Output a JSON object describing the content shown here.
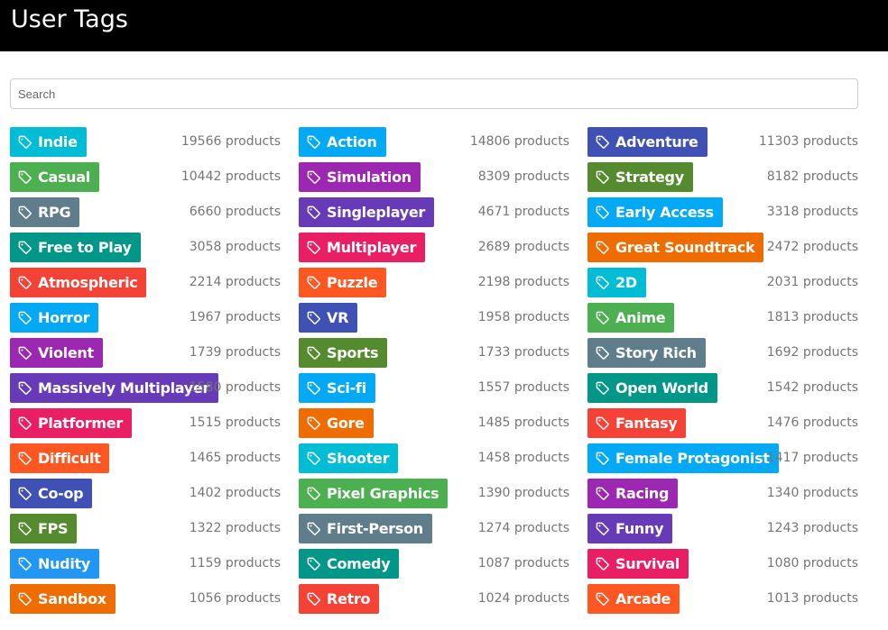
{
  "header": {
    "title": "User Tags"
  },
  "search": {
    "placeholder": "Search",
    "value": ""
  },
  "colors": {
    "cyan": "#00bcd4",
    "lightblue": "#03a9f4",
    "blue": "#2196f3",
    "indigo": "#3f51b5",
    "green": "#4caf50",
    "teal": "#009688",
    "darkgreen": "#558b2f",
    "purple": "#9c27b0",
    "deeppurple": "#673ab7",
    "pink": "#e91e63",
    "red": "#f44336",
    "deeporange": "#ff5722",
    "orange": "#ef6c00",
    "grey": "#607d8b"
  },
  "tags": [
    {
      "name": "Indie",
      "count": "19566 products",
      "color": "#00bcd4"
    },
    {
      "name": "Action",
      "count": "14806 products",
      "color": "#03a9f4"
    },
    {
      "name": "Adventure",
      "count": "11303 products",
      "color": "#3f51b5"
    },
    {
      "name": "Casual",
      "count": "10442 products",
      "color": "#4caf50"
    },
    {
      "name": "Simulation",
      "count": "8309 products",
      "color": "#9c27b0"
    },
    {
      "name": "Strategy",
      "count": "8182 products",
      "color": "#558b2f"
    },
    {
      "name": "RPG",
      "count": "6660 products",
      "color": "#607d8b"
    },
    {
      "name": "Singleplayer",
      "count": "4671 products",
      "color": "#673ab7"
    },
    {
      "name": "Early Access",
      "count": "3318 products",
      "color": "#03a9f4"
    },
    {
      "name": "Free to Play",
      "count": "3058 products",
      "color": "#009688"
    },
    {
      "name": "Multiplayer",
      "count": "2689 products",
      "color": "#e91e63"
    },
    {
      "name": "Great Soundtrack",
      "count": "2472 products",
      "color": "#ef6c00"
    },
    {
      "name": "Atmospheric",
      "count": "2214 products",
      "color": "#f44336"
    },
    {
      "name": "Puzzle",
      "count": "2198 products",
      "color": "#ff5722"
    },
    {
      "name": "2D",
      "count": "2031 products",
      "color": "#00bcd4"
    },
    {
      "name": "Horror",
      "count": "1967 products",
      "color": "#03a9f4"
    },
    {
      "name": "VR",
      "count": "1958 products",
      "color": "#3f51b5"
    },
    {
      "name": "Anime",
      "count": "1813 products",
      "color": "#4caf50"
    },
    {
      "name": "Violent",
      "count": "1739 products",
      "color": "#9c27b0"
    },
    {
      "name": "Sports",
      "count": "1733 products",
      "color": "#558b2f"
    },
    {
      "name": "Story Rich",
      "count": "1692 products",
      "color": "#607d8b"
    },
    {
      "name": "Massively Multiplayer",
      "count": "1580 products",
      "color": "#673ab7"
    },
    {
      "name": "Sci-fi",
      "count": "1557 products",
      "color": "#03a9f4"
    },
    {
      "name": "Open World",
      "count": "1542 products",
      "color": "#009688"
    },
    {
      "name": "Platformer",
      "count": "1515 products",
      "color": "#e91e63"
    },
    {
      "name": "Gore",
      "count": "1485 products",
      "color": "#ef6c00"
    },
    {
      "name": "Fantasy",
      "count": "1476 products",
      "color": "#f44336"
    },
    {
      "name": "Difficult",
      "count": "1465 products",
      "color": "#ff5722"
    },
    {
      "name": "Shooter",
      "count": "1458 products",
      "color": "#00bcd4"
    },
    {
      "name": "Female Protagonist",
      "count": "1417 products",
      "color": "#03a9f4"
    },
    {
      "name": "Co-op",
      "count": "1402 products",
      "color": "#3f51b5"
    },
    {
      "name": "Pixel Graphics",
      "count": "1390 products",
      "color": "#4caf50"
    },
    {
      "name": "Racing",
      "count": "1340 products",
      "color": "#9c27b0"
    },
    {
      "name": "FPS",
      "count": "1322 products",
      "color": "#558b2f"
    },
    {
      "name": "First-Person",
      "count": "1274 products",
      "color": "#607d8b"
    },
    {
      "name": "Funny",
      "count": "1243 products",
      "color": "#673ab7"
    },
    {
      "name": "Nudity",
      "count": "1159 products",
      "color": "#2196f3"
    },
    {
      "name": "Comedy",
      "count": "1087 products",
      "color": "#009688"
    },
    {
      "name": "Survival",
      "count": "1080 products",
      "color": "#e91e63"
    },
    {
      "name": "Sandbox",
      "count": "1056 products",
      "color": "#ef6c00"
    },
    {
      "name": "Retro",
      "count": "1024 products",
      "color": "#f44336"
    },
    {
      "name": "Arcade",
      "count": "1013 products",
      "color": "#ff5722"
    }
  ],
  "tag_icon": "tag-icon"
}
